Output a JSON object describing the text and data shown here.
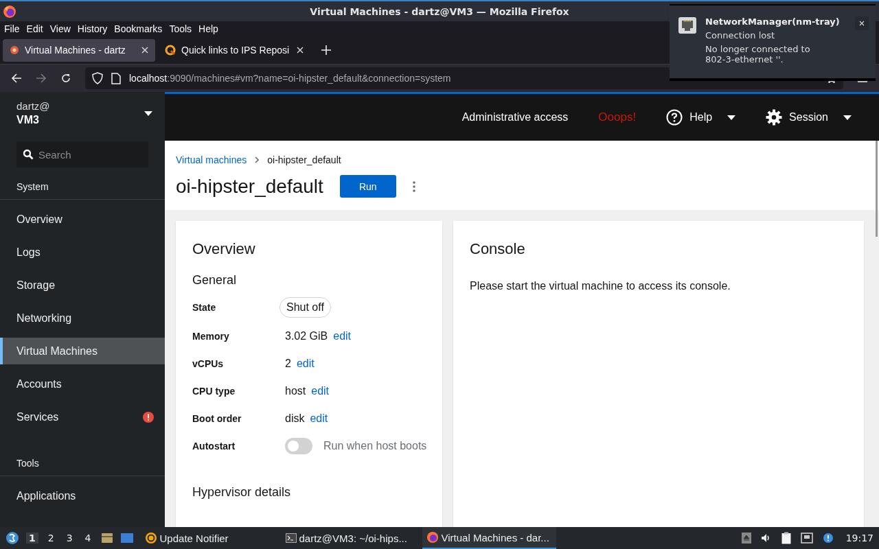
{
  "window": {
    "title": "Virtual Machines - dartz@VM3 — Mozilla Firefox"
  },
  "menu": [
    "File",
    "Edit",
    "View",
    "History",
    "Bookmarks",
    "Tools",
    "Help"
  ],
  "tabs": [
    {
      "label": "Virtual Machines - dartz",
      "selected": true
    },
    {
      "label": "Quick links to IPS Reposi",
      "selected": false
    }
  ],
  "address": {
    "host": "localhost",
    "path": ":9090/machines#vm?name=oi-hipster_default&connection=system"
  },
  "notification": {
    "title": "NetworkManager(nm-tray)",
    "summary": "Connection lost",
    "body": "No longer connected to 802-3-ethernet ''."
  },
  "sidebar": {
    "user": "dartz@",
    "host": "VM3",
    "search_placeholder": "Search",
    "sections": [
      {
        "title": "System",
        "items": [
          {
            "label": "Overview",
            "selected": false,
            "alert": false
          },
          {
            "label": "Logs",
            "selected": false,
            "alert": false
          },
          {
            "label": "Storage",
            "selected": false,
            "alert": false
          },
          {
            "label": "Networking",
            "selected": false,
            "alert": false
          },
          {
            "label": "Virtual Machines",
            "selected": true,
            "alert": false
          },
          {
            "label": "Accounts",
            "selected": false,
            "alert": false
          },
          {
            "label": "Services",
            "selected": false,
            "alert": true
          }
        ]
      },
      {
        "title": "Tools",
        "items": [
          {
            "label": "Applications",
            "selected": false,
            "alert": false
          }
        ]
      }
    ]
  },
  "header": {
    "access": "Administrative access",
    "warning": "Ooops!",
    "help": "Help",
    "session": "Session"
  },
  "breadcrumb": [
    "Virtual machines",
    "oi-hipster_default"
  ],
  "page": {
    "title": "oi-hipster_default",
    "run_button": "Run"
  },
  "overview": {
    "title": "Overview",
    "general": "General",
    "fields": [
      {
        "kind": "badge",
        "label": "State",
        "value": "Shut off"
      },
      {
        "kind": "editable",
        "label": "Memory",
        "value": "3.02 GiB",
        "link": "edit"
      },
      {
        "kind": "editable",
        "label": "vCPUs",
        "value": "2",
        "link": "edit"
      },
      {
        "kind": "editable",
        "label": "CPU type",
        "value": "host",
        "link": "edit"
      },
      {
        "kind": "editable",
        "label": "Boot order",
        "value": "disk",
        "link": "edit"
      },
      {
        "kind": "switch",
        "label": "Autostart",
        "on": false,
        "value": "Run when host boots"
      }
    ],
    "hypervisor": "Hypervisor details"
  },
  "console": {
    "title": "Console",
    "message": "Please start the virtual machine to access its console."
  },
  "taskbar": {
    "workspaces": [
      {
        "label": "1",
        "selected": true
      },
      {
        "label": "2",
        "selected": false
      },
      {
        "label": "3",
        "selected": false
      },
      {
        "label": "4",
        "selected": false
      }
    ],
    "tasks": [
      {
        "kind": "update",
        "label": "Update Notifier",
        "selected": false
      },
      {
        "kind": "terminal",
        "label": "dartz@VM3: ~/oi-hips...",
        "selected": false
      },
      {
        "kind": "browser",
        "label": "Virtual Machines - dar...",
        "selected": true
      }
    ],
    "clock": "19:17"
  }
}
